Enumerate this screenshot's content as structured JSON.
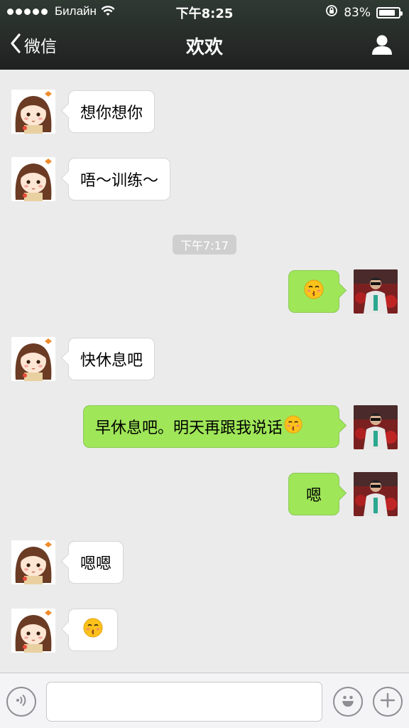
{
  "statusbar": {
    "carrier": "Билайн",
    "time": "下午8:25",
    "battery": "83%",
    "battery_level": 0.83
  },
  "navbar": {
    "back_label": "微信",
    "title": "欢欢"
  },
  "messages": [
    {
      "side": "in",
      "text": "想你想你"
    },
    {
      "side": "in",
      "text": "唔～训练～"
    },
    {
      "side": "timestamp",
      "text": "下午7:17"
    },
    {
      "side": "out",
      "emoji": "kissing-face-emoji"
    },
    {
      "side": "in",
      "text": "快休息吧"
    },
    {
      "side": "out",
      "text": "早休息吧。明天再跟我说话",
      "emoji": "kissing-face-emoji"
    },
    {
      "side": "out",
      "text": "嗯"
    },
    {
      "side": "in",
      "text": "嗯嗯"
    },
    {
      "side": "in",
      "emoji": "kissing-face-emoji"
    }
  ],
  "inputbar": {
    "value": "",
    "voice_icon": "voice-icon",
    "emoji_icon": "smiley-icon",
    "plus_icon": "plus-icon"
  },
  "colors": {
    "header": "#262a28",
    "incoming_bubble": "#ffffff",
    "outgoing_bubble": "#9fe658",
    "background": "#ebebeb"
  }
}
